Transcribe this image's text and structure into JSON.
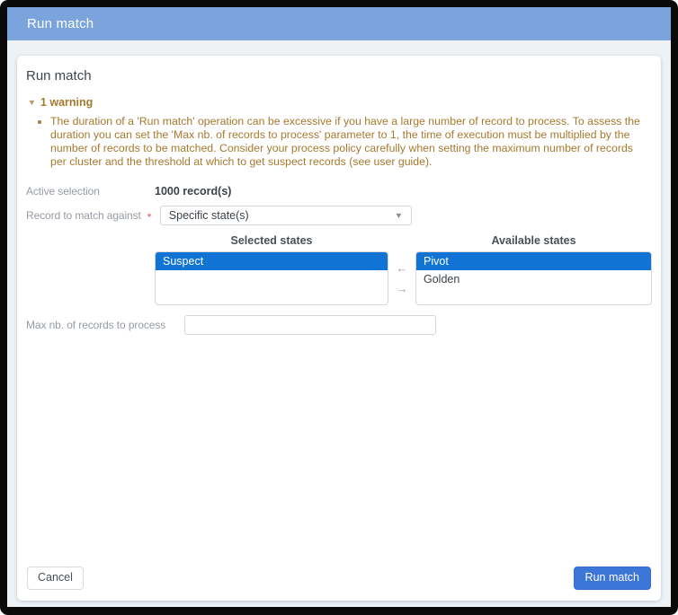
{
  "window": {
    "title": "Run match"
  },
  "dialog": {
    "heading": "Run match",
    "warning": {
      "toggle_label": "1 warning",
      "caret_glyph": "▼",
      "items": [
        "The duration of a 'Run match' operation can be excessive if you have a large number of record to process. To assess the duration you can set the 'Max nb. of records to process' parameter to 1, the time of execution must be multiplied by the number of records to be matched. Consider your process policy carefully when setting the maximum number of records per cluster and the threshold at which to get suspect records (see user guide)."
      ]
    },
    "fields": {
      "active_selection": {
        "label": "Active selection",
        "value": "1000 record(s)"
      },
      "record_to_match": {
        "label": "Record to match against",
        "required_marker": "*",
        "value": "Specific state(s)",
        "caret_glyph": "▼"
      },
      "max_records": {
        "label": "Max nb. of records to process",
        "value": ""
      }
    },
    "dual_list": {
      "left": {
        "header": "Selected states",
        "items": [
          {
            "label": "Suspect",
            "selected": true
          }
        ]
      },
      "right": {
        "header": "Available states",
        "items": [
          {
            "label": "Pivot",
            "selected": true
          },
          {
            "label": "Golden",
            "selected": false
          }
        ]
      },
      "move_left_glyph": "←",
      "move_right_glyph": "→"
    },
    "footer": {
      "cancel_label": "Cancel",
      "submit_label": "Run match"
    }
  },
  "colors": {
    "header_bar": "#7ba4dc",
    "page_background": "#eff2f5",
    "selection_blue": "#1174d4",
    "primary_button": "#3c76d6",
    "warning_text": "#a6792e",
    "label_gray": "#969ca4",
    "required_red": "#e05252"
  }
}
